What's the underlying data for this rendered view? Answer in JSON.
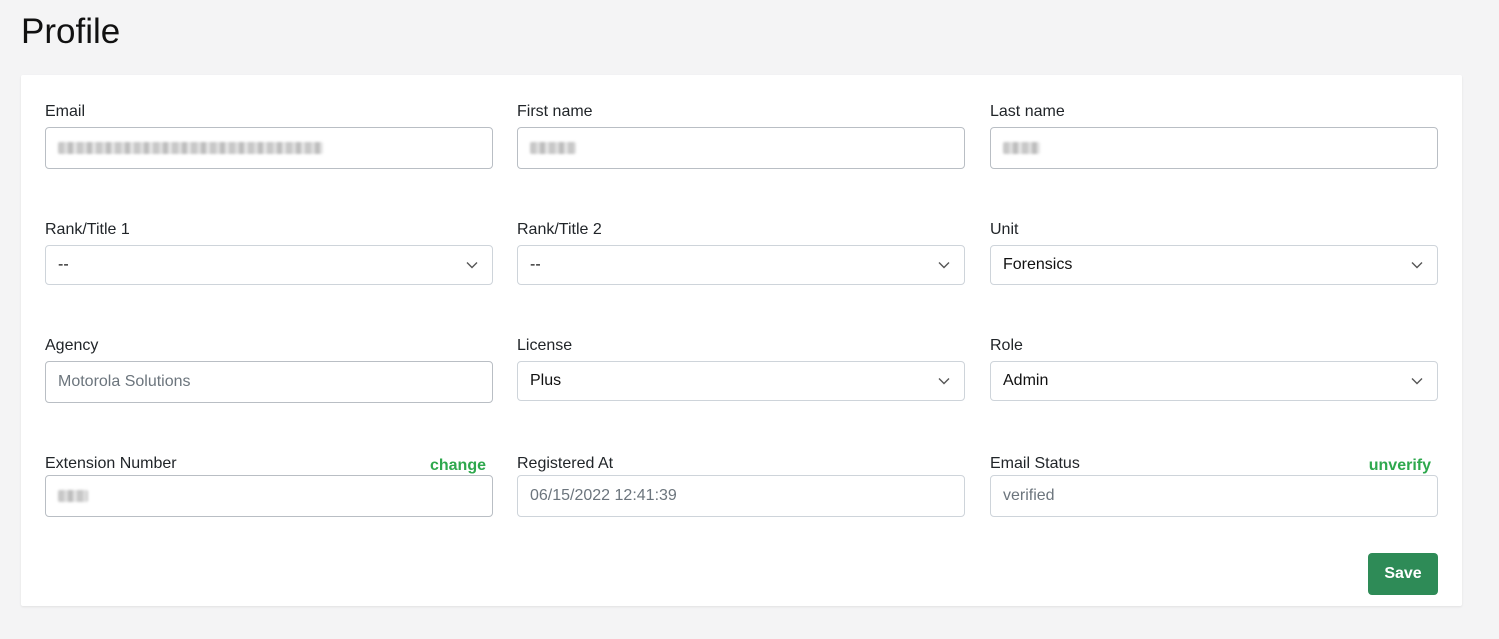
{
  "page": {
    "title": "Profile"
  },
  "fields": {
    "email": {
      "label": "Email"
    },
    "first_name": {
      "label": "First name"
    },
    "last_name": {
      "label": "Last name"
    },
    "rank1": {
      "label": "Rank/Title 1",
      "value": "--"
    },
    "rank2": {
      "label": "Rank/Title 2",
      "value": "--"
    },
    "unit": {
      "label": "Unit",
      "value": "Forensics"
    },
    "agency": {
      "label": "Agency",
      "value": "Motorola Solutions"
    },
    "license": {
      "label": "License",
      "value": "Plus"
    },
    "role": {
      "label": "Role",
      "value": "Admin"
    },
    "extension": {
      "label": "Extension Number",
      "action": "change"
    },
    "registered": {
      "label": "Registered At",
      "value": "06/15/2022 12:41:39"
    },
    "email_status": {
      "label": "Email Status",
      "value": "verified",
      "action": "unverify"
    }
  },
  "actions": {
    "save_label": "Save"
  },
  "colors": {
    "accent_green": "#2ea84d",
    "save_button": "#2e8b57"
  },
  "icons": {
    "select_arrow": "chevron-down-icon"
  }
}
